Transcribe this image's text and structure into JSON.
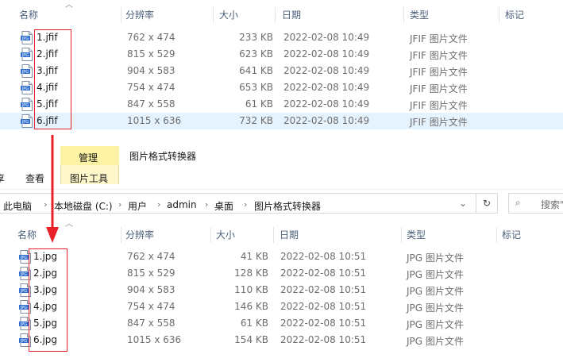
{
  "colors": {
    "highlight": "#e8202a",
    "selected_row": "#cce8ff",
    "tab_yellow": "#fbf3a3"
  },
  "columns": {
    "name": "名称",
    "resolution": "分辨率",
    "size": "大小",
    "date": "日期",
    "type": "类型",
    "tags": "标记"
  },
  "top_files": [
    {
      "name": "1.jfif",
      "resolution": "762 x 474",
      "size": "233 KB",
      "date": "2022-02-08 10:49",
      "type": "JFIF 图片文件"
    },
    {
      "name": "2.jfif",
      "resolution": "815 x 529",
      "size": "623 KB",
      "date": "2022-02-08 10:49",
      "type": "JFIF 图片文件"
    },
    {
      "name": "3.jfif",
      "resolution": "904 x 583",
      "size": "641 KB",
      "date": "2022-02-08 10:49",
      "type": "JFIF 图片文件"
    },
    {
      "name": "4.jfif",
      "resolution": "754 x 474",
      "size": "653 KB",
      "date": "2022-02-08 10:49",
      "type": "JFIF 图片文件"
    },
    {
      "name": "5.jfif",
      "resolution": "847 x 558",
      "size": "61 KB",
      "date": "2022-02-08 10:49",
      "type": "JFIF 图片文件"
    },
    {
      "name": "6.jfif",
      "resolution": "1015 x 636",
      "size": "732 KB",
      "date": "2022-02-08 10:49",
      "type": "JFIF 图片文件"
    }
  ],
  "ribbon": {
    "manage_tab": "管理",
    "window_title": "图片格式转换器",
    "partial_tab": "享",
    "view_tab": "查看",
    "picture_tools": "图片工具"
  },
  "breadcrumbs": [
    "此电脑",
    "本地磁盘 (C:)",
    "用户",
    "admin",
    "桌面",
    "图片格式转换器"
  ],
  "search_placeholder": "搜索\"",
  "bottom_files": [
    {
      "name": "1.jpg",
      "resolution": "762 x 474",
      "size": "41 KB",
      "date": "2022-02-08 10:51",
      "type": "JPG 图片文件"
    },
    {
      "name": "2.jpg",
      "resolution": "815 x 529",
      "size": "128 KB",
      "date": "2022-02-08 10:51",
      "type": "JPG 图片文件"
    },
    {
      "name": "3.jpg",
      "resolution": "904 x 583",
      "size": "110 KB",
      "date": "2022-02-08 10:51",
      "type": "JPG 图片文件"
    },
    {
      "name": "4.jpg",
      "resolution": "754 x 474",
      "size": "146 KB",
      "date": "2022-02-08 10:51",
      "type": "JPG 图片文件"
    },
    {
      "name": "5.jpg",
      "resolution": "847 x 558",
      "size": "61 KB",
      "date": "2022-02-08 10:51",
      "type": "JPG 图片文件"
    },
    {
      "name": "6.jpg",
      "resolution": "1015 x 636",
      "size": "154 KB",
      "date": "2022-02-08 10:51",
      "type": "JPG 图片文件"
    }
  ]
}
